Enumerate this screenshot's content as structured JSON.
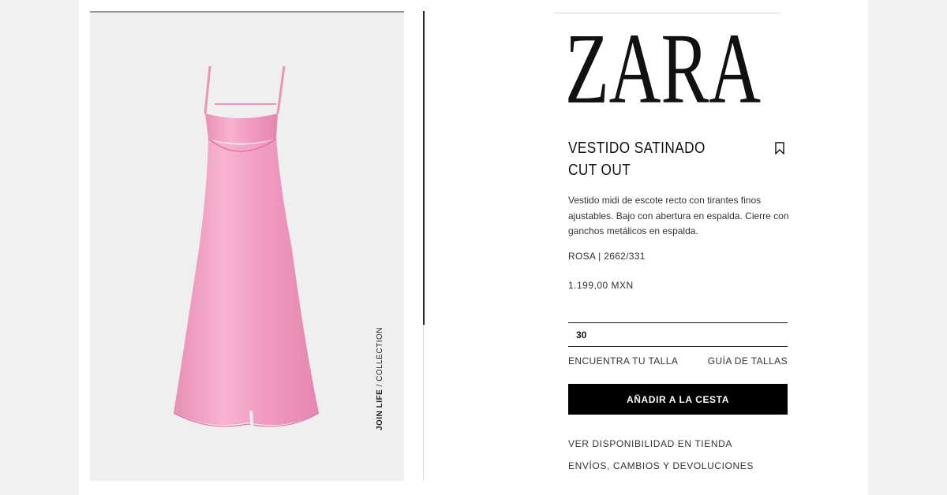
{
  "brand": {
    "logo_text": "ZARA"
  },
  "product": {
    "title": "VESTIDO SATINADO CUT OUT",
    "description": "Vestido midi de escote recto con tirantes finos ajustables. Bajo con abertura en espalda. Cierre con ganchos metálicos en espalda.",
    "color_code": "ROSA | 2662/331",
    "price": "1.199,00 MXN",
    "selected_size": "30",
    "dress_color": "#f4a6c8"
  },
  "image_caption": {
    "bold": "JOIN LIFE",
    "rest": " / COLLECTION"
  },
  "links": {
    "find_size": "ENCUENTRA TU TALLA",
    "size_guide": "GUÍA DE TALLAS",
    "availability": "VER DISPONIBILIDAD EN TIENDA",
    "shipping": "ENVÍOS, CAMBIOS Y DEVOLUCIONES"
  },
  "buttons": {
    "add_to_cart": "AÑADIR A LA CESTA"
  },
  "icons": {
    "bookmark": "bookmark-icon"
  }
}
